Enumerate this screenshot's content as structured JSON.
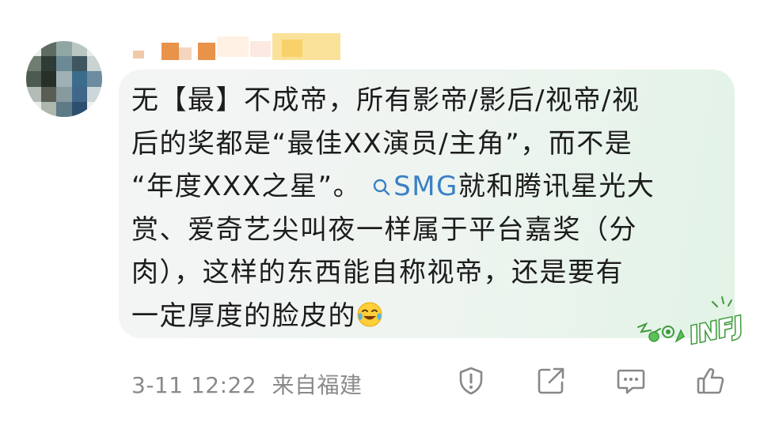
{
  "comment": {
    "text_lines": [
      "无【最】不成帝，所有影帝/影后/视帝/视",
      "后的奖都是“最佳XX演员/主角”，而不是",
      "“年度XXX之星”。",
      "就和腾讯星光大",
      "赏、爱奇艺尖叫夜一样属于平台嘉奖（分",
      "肉），这样的东西能自称视帝，还是要有",
      "一定厚度的脸皮的"
    ],
    "topic_link": "SMG",
    "emoji": "laugh-cry-emoji",
    "badge_text": "INFJ"
  },
  "meta": {
    "timestamp": "3-11 12:22",
    "location": "来自福建"
  },
  "actions": {
    "icons": [
      "report-icon",
      "share-icon",
      "reply-icon",
      "like-icon"
    ]
  },
  "colors": {
    "topic": "#3a7fc4",
    "meta_text": "#8a8a8a",
    "badge_green": "#3d9a3a"
  }
}
